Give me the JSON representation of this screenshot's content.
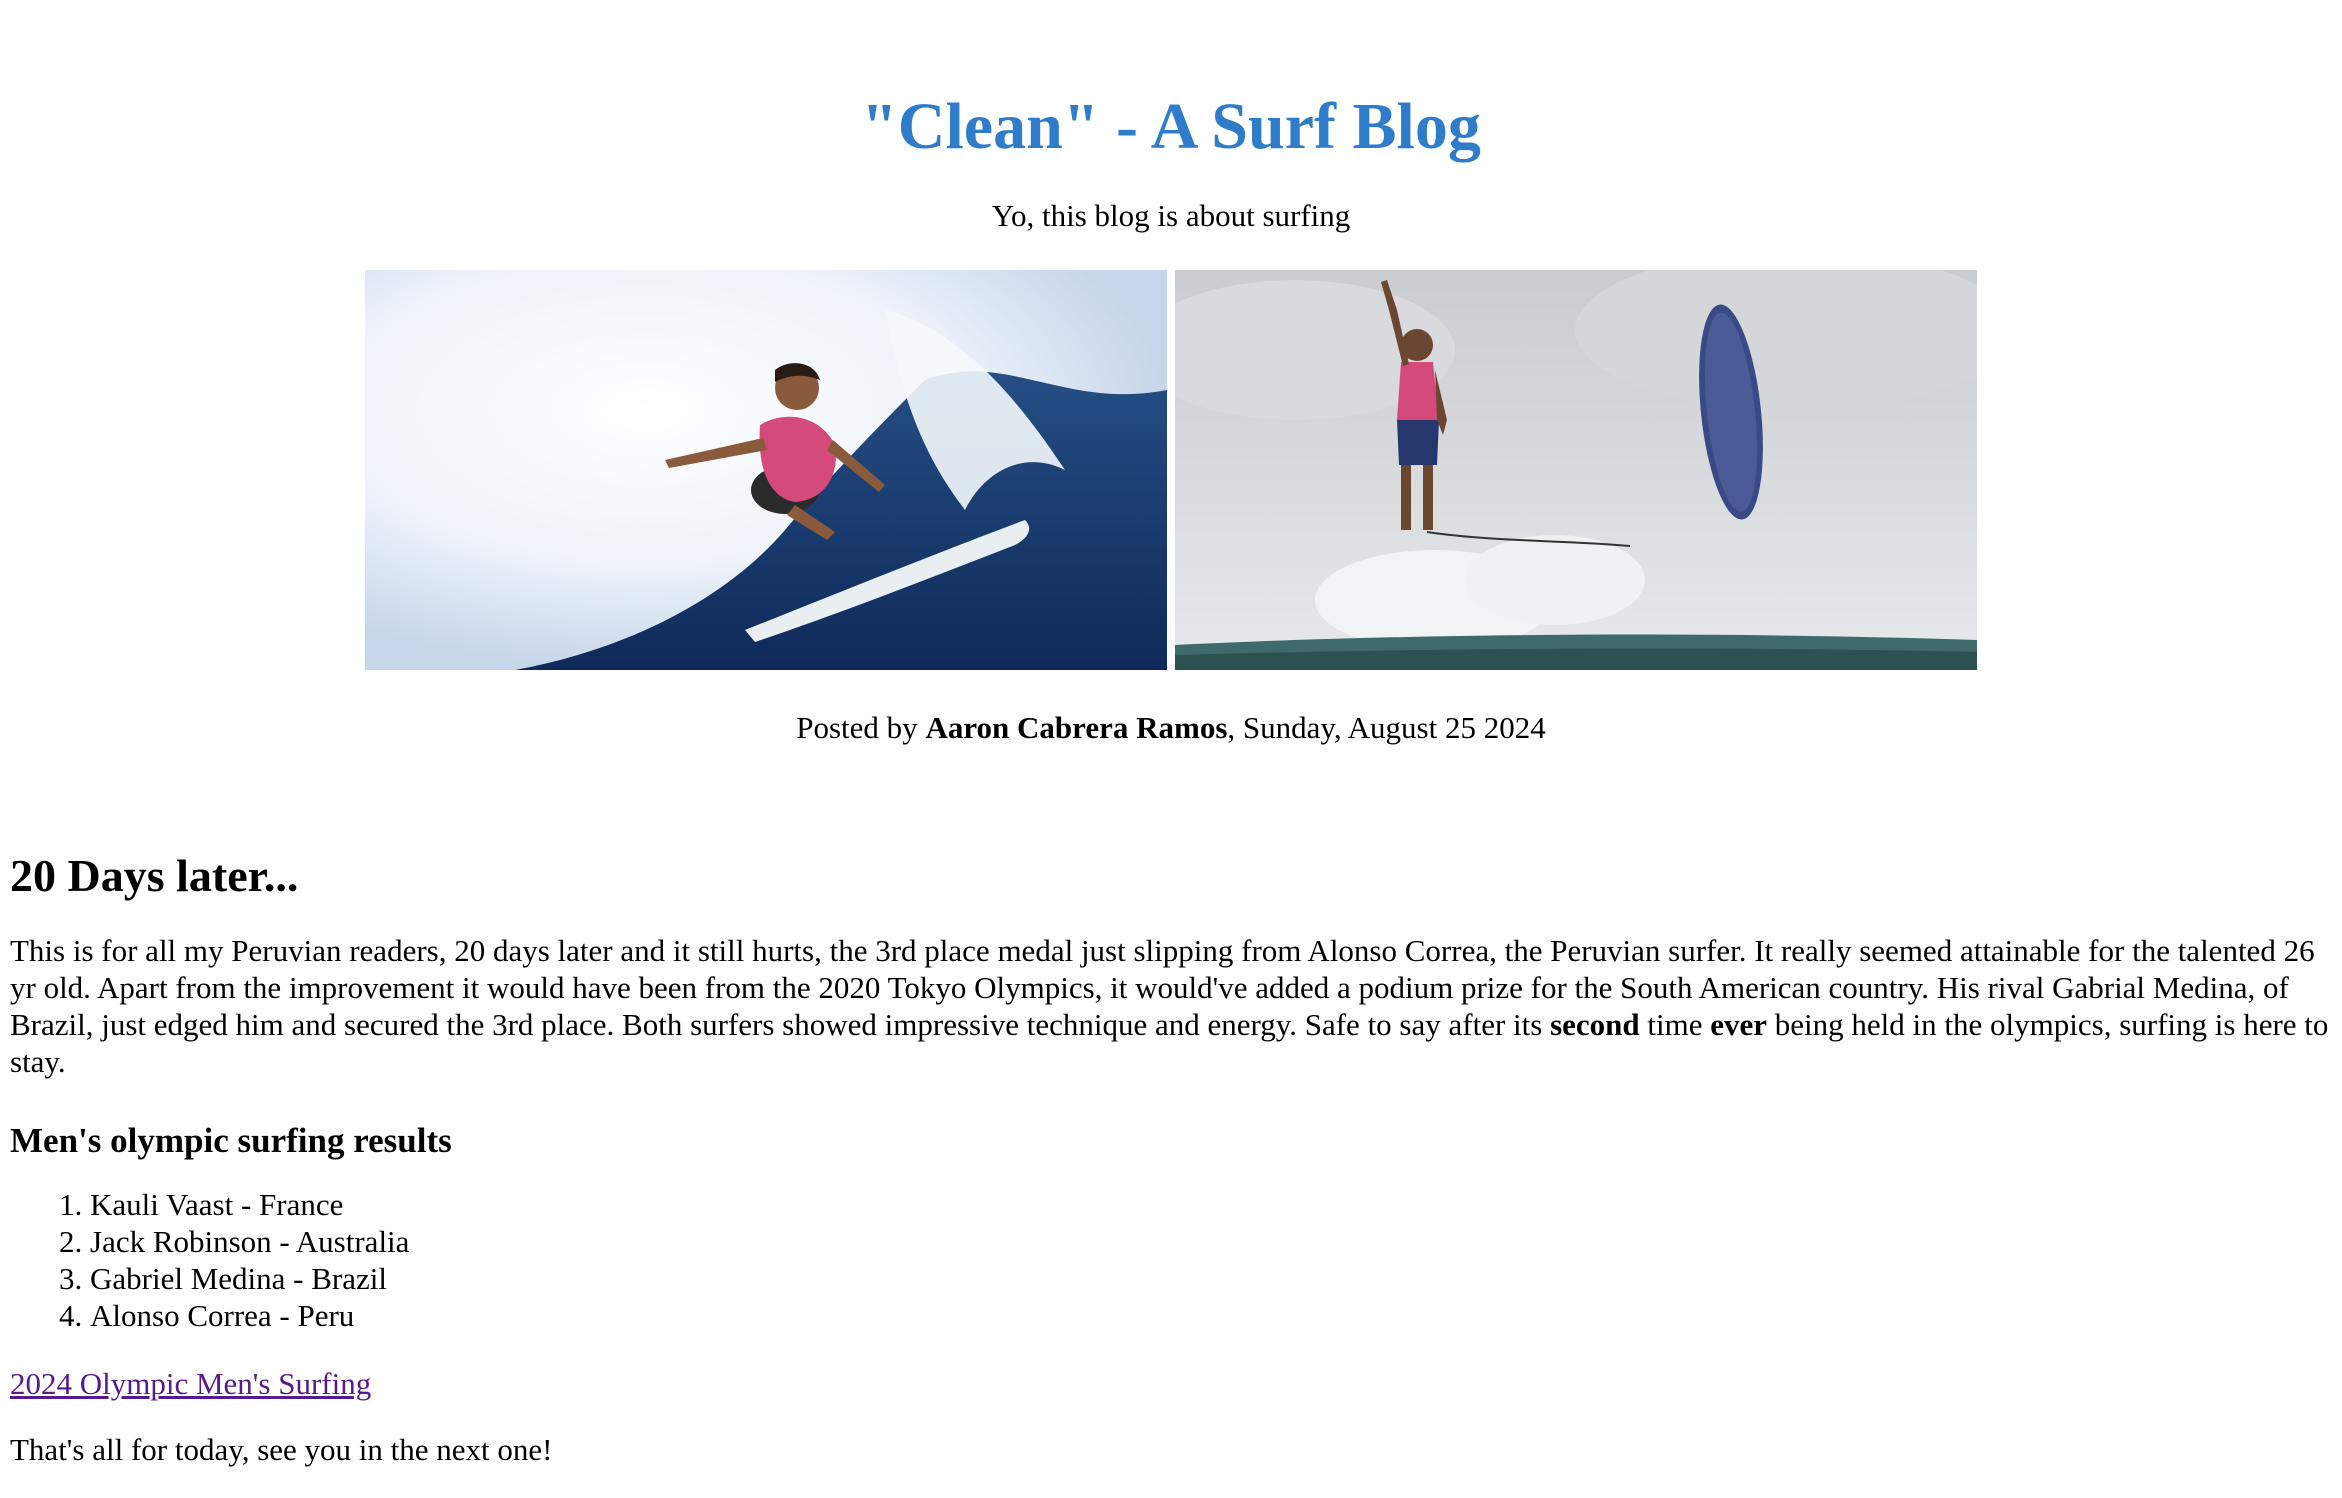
{
  "header": {
    "title": "\"Clean\" - A Surf Blog",
    "subtitle": "Yo, this blog is about surfing"
  },
  "photos": [
    {
      "alt": "surfer-carving-wave-photo"
    },
    {
      "alt": "surfer-jumping-photo"
    }
  ],
  "byline": {
    "prefix": "Posted by ",
    "author": "Aaron Cabrera Ramos",
    "date": ", Sunday, August 25 2024"
  },
  "post": {
    "title": "20 Days later...",
    "body_part1": "This is for all my Peruvian readers, 20 days later and it still hurts, the 3rd place medal just slipping from Alonso Correa, the Peruvian surfer. It really seemed attainable for the talented 26 yr old. Apart from the improvement it would have been from the 2020 Tokyo Olympics, it would've added a podium prize for the South American country. His rival Gabrial Medina, of Brazil, just edged him and secured the 3rd place. Both surfers showed impressive technique and energy. Safe to say after its ",
    "body_bold1": "second",
    "body_part2": " time ",
    "body_bold2": "ever",
    "body_part3": " being held in the olympics, surfing is here to stay.",
    "results_title": "Men's olympic surfing results",
    "results": [
      "Kauli Vaast - France",
      "Jack Robinson - Australia",
      "Gabriel Medina - Brazil",
      "Alonso Correa - Peru"
    ],
    "link_label": "2024 Olympic Men's Surfing",
    "signoff": "That's all for today, see you in the next one!"
  },
  "colors": {
    "title": "#2f7ccb",
    "link_visited": "#551a8b"
  }
}
